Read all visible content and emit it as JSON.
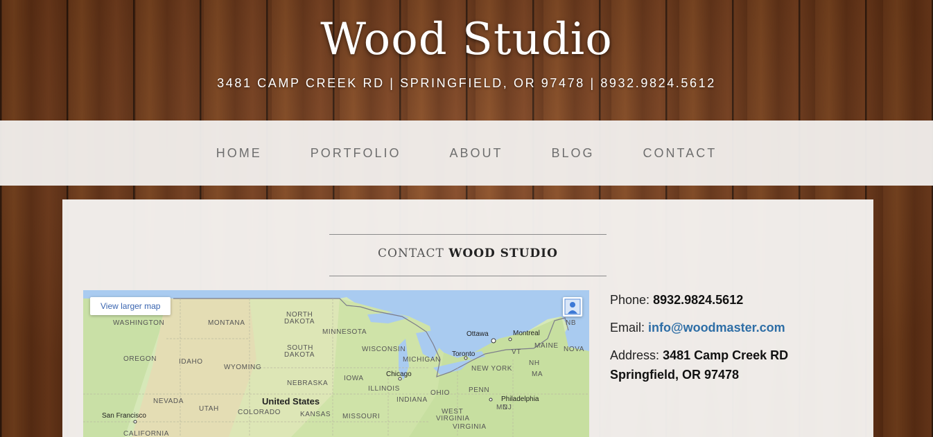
{
  "header": {
    "site_title": "Wood Studio",
    "address_line": "3481 CAMP CREEK RD | SPRINGFIELD, OR 97478 | 8932.9824.5612"
  },
  "nav": {
    "items": [
      {
        "label": "HOME"
      },
      {
        "label": "PORTFOLIO"
      },
      {
        "label": "ABOUT"
      },
      {
        "label": "BLOG"
      },
      {
        "label": "CONTACT"
      }
    ]
  },
  "main": {
    "heading_light": "CONTACT",
    "heading_strong": "WOOD STUDIO",
    "map": {
      "view_larger_label": "View larger map",
      "labels": {
        "washington": "WASHINGTON",
        "montana": "MONTANA",
        "north_dakota_1": "NORTH",
        "north_dakota_2": "DAKOTA",
        "minnesota": "MINNESOTA",
        "wisconsin": "WISCONSIN",
        "ottawa": "Ottawa",
        "montreal": "Montreal",
        "maine": "MAINE",
        "nb": "NB",
        "nova": "NOVA",
        "oregon": "OREGON",
        "idaho": "IDAHO",
        "wyoming": "WYOMING",
        "south_dakota_1": "SOUTH",
        "south_dakota_2": "DAKOTA",
        "michigan": "MICHIGAN",
        "toronto": "Toronto",
        "vt": "VT",
        "nh": "NH",
        "new_york": "NEW YORK",
        "ma": "MA",
        "iowa": "IOWA",
        "chicago": "Chicago",
        "nebraska": "NEBRASKA",
        "illinois": "ILLINOIS",
        "ohio": "OHIO",
        "penn": "PENN",
        "nevada": "NEVADA",
        "utah": "UTAH",
        "united_states": "United States",
        "indiana": "INDIANA",
        "philadelphia": "Philadelphia",
        "md": "MD",
        "nj": "NJ",
        "colorado": "COLORADO",
        "kansas": "KANSAS",
        "missouri": "MISSOURI",
        "west_virginia_1": "WEST",
        "west_virginia_2": "VIRGINIA",
        "virginia": "VIRGINIA",
        "san_francisco": "San Francisco",
        "california": "CALIFORNIA"
      }
    },
    "contact": {
      "phone_label": "Phone:",
      "phone_value": "8932.9824.5612",
      "email_label": "Email:",
      "email_value": "info@woodmaster.com",
      "address_label": "Address:",
      "address_line1": "3481 Camp Creek RD",
      "address_line2": "Springfield, OR 97478"
    }
  },
  "colors": {
    "link": "#2e6ea6",
    "nav_text": "#6e6e6e",
    "wood": "#7a401c"
  }
}
